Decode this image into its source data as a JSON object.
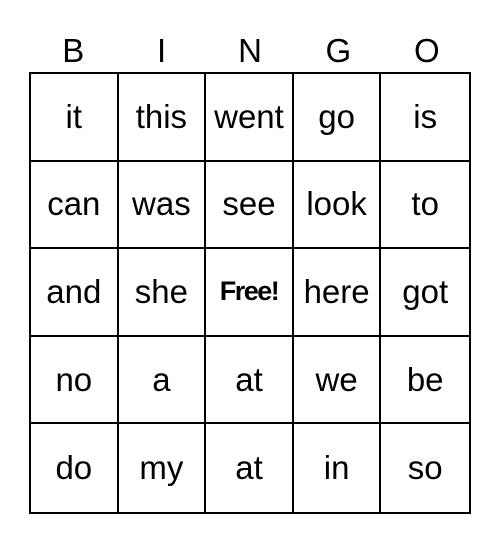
{
  "header": [
    "B",
    "I",
    "N",
    "G",
    "O"
  ],
  "rows": [
    [
      "it",
      "this",
      "went",
      "go",
      "is"
    ],
    [
      "can",
      "was",
      "see",
      "look",
      "to"
    ],
    [
      "and",
      "she",
      "Free!",
      "here",
      "got"
    ],
    [
      "no",
      "a",
      "at",
      "we",
      "be"
    ],
    [
      "do",
      "my",
      "at",
      "in",
      "so"
    ]
  ],
  "free_space": {
    "row": 2,
    "col": 2,
    "label": "Free!"
  }
}
